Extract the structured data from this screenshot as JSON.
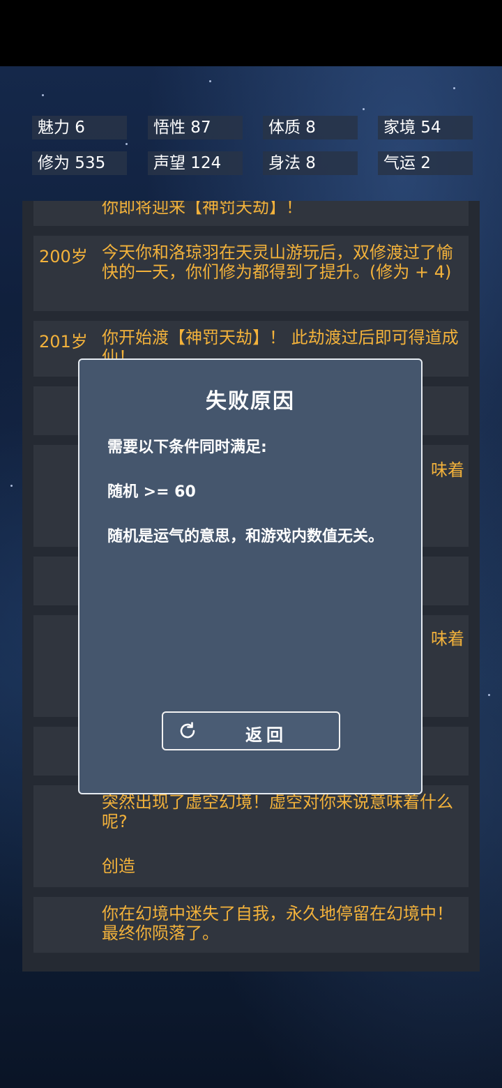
{
  "stats": [
    {
      "label": "魅力 6"
    },
    {
      "label": "悟性 87"
    },
    {
      "label": "体质 8"
    },
    {
      "label": "家境 54"
    },
    {
      "label": "修为 535"
    },
    {
      "label": "声望 124"
    },
    {
      "label": "身法 8"
    },
    {
      "label": "气运 2"
    }
  ],
  "log": {
    "entry0": {
      "text": "你即将迎来【神罚天劫】！"
    },
    "entry1": {
      "age": "200岁",
      "text": "今天你和洛琼羽在天灵山游玩后，双修渡过了愉快的一天，你们修为都得到了提升。(修为 + 4)"
    },
    "entry2": {
      "age": "201岁",
      "text": "你开始渡【神罚天劫】！ 此劫渡过后即可得道成仙！"
    },
    "entry4": {
      "fragment": "味着"
    },
    "entry6": {
      "fragment": "味着"
    },
    "entry8": {
      "text": "突然出现了虚空幻境！虚空对你来说意味着什么呢?",
      "choice": "创造"
    },
    "entry9": {
      "text": "你在幻境中迷失了自我，永久地停留在幻境中！最终你陨落了。"
    }
  },
  "modal": {
    "title": "失败原因",
    "line1": "需要以下条件同时满足:",
    "line2": "随机 >= 60",
    "line3": "随机是运气的意思，和游戏内数值无关。",
    "button": "返回"
  },
  "colors": {
    "accent_text": "#f3b23b",
    "modal_bg": "#45566d"
  }
}
